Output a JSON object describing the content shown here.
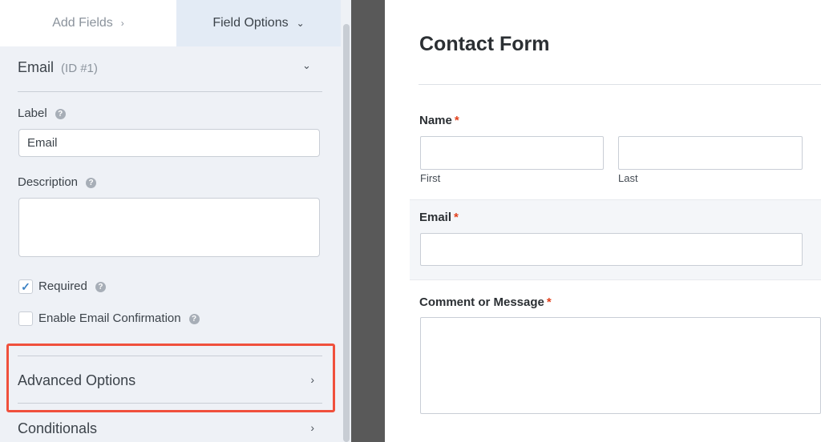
{
  "tabs": {
    "add_fields": "Add Fields",
    "add_fields_chevron": "›",
    "field_options": "Field Options",
    "field_options_chevron": "⌄"
  },
  "field": {
    "name": "Email",
    "id": "(ID #1)"
  },
  "options": {
    "label_title": "Label",
    "label_value": "Email",
    "description_title": "Description",
    "description_value": "",
    "required_label": "Required",
    "required_checked": true,
    "confirm_label": "Enable Email Confirmation",
    "confirm_checked": false,
    "help_glyph": "?"
  },
  "sections": {
    "advanced": "Advanced Options",
    "conditionals": "Conditionals",
    "chevron": "›"
  },
  "preview": {
    "title": "Contact Form",
    "name_label": "Name",
    "first_sublabel": "First",
    "last_sublabel": "Last",
    "email_label": "Email",
    "comment_label": "Comment or Message",
    "required_mark": "*"
  },
  "colors": {
    "panel_bg": "#eef1f6",
    "active_tab_bg": "#e3ebf5",
    "highlight": "#f0503c",
    "required": "#e2401c",
    "checkmark": "#3b82c4",
    "splitter": "#595959"
  },
  "icons": {
    "check": "✓",
    "header_chevron": "⌄"
  }
}
